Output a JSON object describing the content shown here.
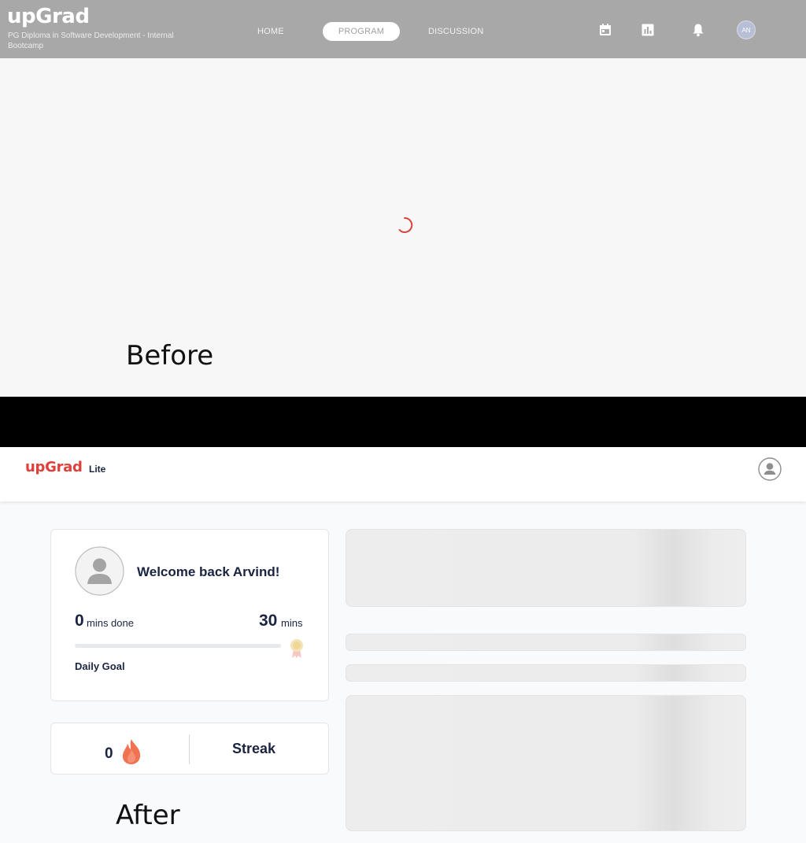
{
  "before": {
    "brand": "upGrad",
    "program_name": "PG Diploma in Software Development - Internal Bootcamp",
    "nav": {
      "home": "HOME",
      "program": "PROGRAM",
      "discussion": "DISCUSSION"
    },
    "icons": {
      "calendar": "calendar-icon",
      "chart": "bar-chart-icon",
      "bell": "bell-icon"
    },
    "avatar_initials": "AN",
    "loading": "spinner",
    "label": "Before"
  },
  "after": {
    "brand": "upGrad",
    "brand_suffix": "Lite",
    "welcome": "Welcome back Arvind!",
    "mins_done_value": "0",
    "mins_done_label": "mins done",
    "goal_value": "30",
    "goal_label": "mins",
    "progress_fraction": 0,
    "daily_goal_label": "Daily Goal",
    "streak_count": "0",
    "streak_label": "Streak",
    "label": "After"
  },
  "colors": {
    "brand_red": "#e0403a",
    "navy_text": "#1a2440",
    "before_header_grey": "#a8a8a8",
    "spinner_red": "#d8443c",
    "skeleton_grey": "#ececec"
  }
}
